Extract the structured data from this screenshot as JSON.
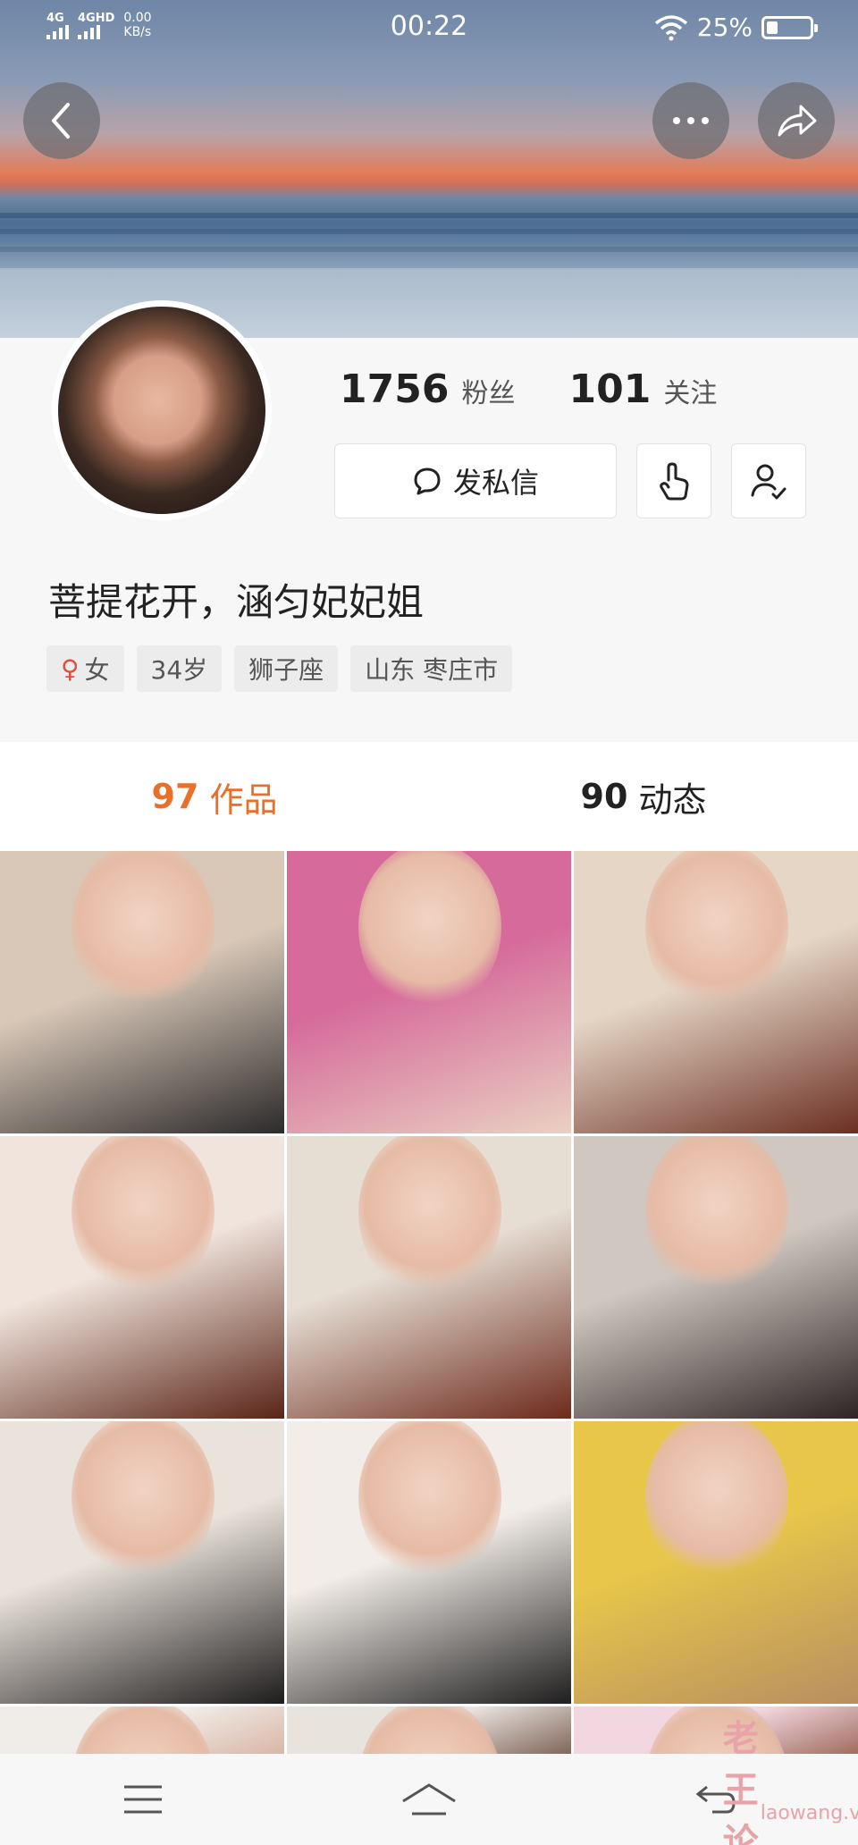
{
  "status": {
    "signal1": "4G",
    "signal2": "4GHD",
    "netspeed_value": "0.00",
    "netspeed_unit": "KB/s",
    "time": "00:22",
    "battery": "25%",
    "battery_level": 0.25
  },
  "nav": {
    "back_icon": "chevron-left-icon",
    "more_icon": "more-dots-icon",
    "share_icon": "share-arrow-icon"
  },
  "profile": {
    "followers_count": "1756",
    "followers_label": "粉丝",
    "following_count": "101",
    "following_label": "关注",
    "message_label": "发私信",
    "nickname": "菩提花开，涵匀妃妃姐",
    "tags": [
      "女",
      "34岁",
      "狮子座",
      "山东 枣庄市"
    ]
  },
  "tabs": [
    {
      "count": "97",
      "label": "作品",
      "active": true
    },
    {
      "count": "90",
      "label": "动态",
      "active": false
    }
  ],
  "grid": {
    "items": [
      {
        "color": "#d9c8b8",
        "accent": "#2c2a2b"
      },
      {
        "color": "#d66a9a",
        "accent": "#e9d1c2"
      },
      {
        "color": "#e5d6c6",
        "accent": "#6b2f22"
      },
      {
        "color": "#f0e4dc",
        "accent": "#5a2417"
      },
      {
        "color": "#e6ddd3",
        "accent": "#6d2a1c"
      },
      {
        "color": "#cfc7c0",
        "accent": "#2d2524"
      },
      {
        "color": "#eae3dc",
        "accent": "#1e1c1c"
      },
      {
        "color": "#f2ede8",
        "accent": "#1f1e1e"
      },
      {
        "color": "#e7c64a",
        "accent": "#b88e61"
      },
      {
        "color": "#f0ece8",
        "accent": "#d9b3a2"
      },
      {
        "color": "#e9e3de",
        "accent": "#7b5f53"
      },
      {
        "color": "#f3d7e0",
        "accent": "#9c6757"
      }
    ]
  },
  "watermark": {
    "cn": "老王论坛",
    "en": "laowang.vip"
  }
}
